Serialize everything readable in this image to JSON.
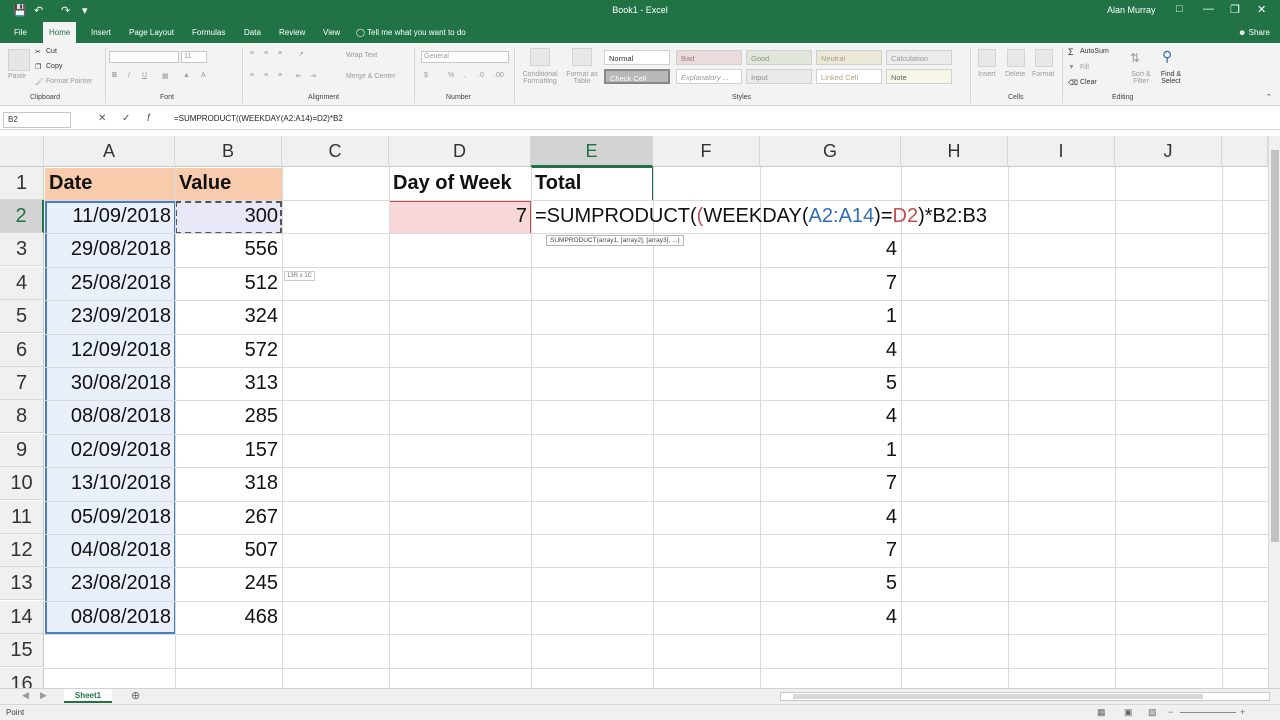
{
  "window": {
    "title": "Book1 - Excel",
    "user": "Alan Murray"
  },
  "tabs": [
    "File",
    "Home",
    "Insert",
    "Page Layout",
    "Formulas",
    "Data",
    "Review",
    "View"
  ],
  "tell_me": "Tell me what you want to do",
  "share": "Share",
  "ribbon": {
    "clipboard": {
      "paste": "Paste",
      "cut": "Cut",
      "copy": "Copy",
      "format_painter": "Format Painter",
      "label": "Clipboard"
    },
    "font": {
      "size": "11",
      "label": "Font"
    },
    "alignment": {
      "wrap": "Wrap Text",
      "merge": "Merge & Center",
      "label": "Alignment"
    },
    "number": {
      "format": "General",
      "label": "Number"
    },
    "styles": {
      "conditional": "Conditional Formatting",
      "format_table": "Format as Table",
      "cells": [
        "Normal",
        "Bad",
        "Good",
        "Neutral",
        "Calculation",
        "Check Cell",
        "Explanatory ...",
        "Input",
        "Linked Cell",
        "Note"
      ],
      "label": "Styles"
    },
    "cells": {
      "insert": "Insert",
      "delete": "Delete",
      "format": "Format",
      "label": "Cells"
    },
    "editing": {
      "autosum": "AutoSum",
      "fill": "Fill",
      "clear": "Clear",
      "sort": "Sort & Filter",
      "find": "Find & Select",
      "label": "Editing"
    }
  },
  "formula_bar": {
    "name_box": "B2",
    "formula": "=SUMPRODUCT((WEEKDAY(A2:A14)=D2)*B2"
  },
  "columns": [
    "A",
    "B",
    "C",
    "D",
    "E",
    "F",
    "G",
    "H",
    "I",
    "J"
  ],
  "rows": [
    "1",
    "2",
    "3",
    "4",
    "5",
    "6",
    "7",
    "8",
    "9",
    "10",
    "11",
    "12",
    "13",
    "14",
    "15",
    "16"
  ],
  "headers": {
    "a1": "Date",
    "b1": "Value",
    "d1": "Day of Week",
    "e1": "Total"
  },
  "data_rows": [
    {
      "date": "11/09/2018",
      "value": "300",
      "weekday": ""
    },
    {
      "date": "29/08/2018",
      "value": "556",
      "weekday": "4"
    },
    {
      "date": "25/08/2018",
      "value": "512",
      "weekday": "7"
    },
    {
      "date": "23/09/2018",
      "value": "324",
      "weekday": "1"
    },
    {
      "date": "12/09/2018",
      "value": "572",
      "weekday": "4"
    },
    {
      "date": "30/08/2018",
      "value": "313",
      "weekday": "5"
    },
    {
      "date": "08/08/2018",
      "value": "285",
      "weekday": "4"
    },
    {
      "date": "02/09/2018",
      "value": "157",
      "weekday": "1"
    },
    {
      "date": "13/10/2018",
      "value": "318",
      "weekday": "7"
    },
    {
      "date": "05/09/2018",
      "value": "267",
      "weekday": "4"
    },
    {
      "date": "04/08/2018",
      "value": "507",
      "weekday": "7"
    },
    {
      "date": "23/08/2018",
      "value": "245",
      "weekday": "5"
    },
    {
      "date": "08/08/2018",
      "value": "468",
      "weekday": "4"
    }
  ],
  "d2_value": "7",
  "e2_formula": {
    "p1": "=SUMPRODUCT(",
    "p2": "(",
    "p3": "WEEKDAY(",
    "p4": "A2:A14",
    "p5": ")=",
    "p6": "D2",
    "p7": ")*B2:B3"
  },
  "tooltip": "SUMPRODUCT(array1, [array2], [array3], ...)",
  "size_tip": "13R x 1C",
  "sheet_tab": "Sheet1",
  "status": "Point",
  "colors": {
    "excel_green": "#217346",
    "range_blue": "#2f6db5",
    "range_red": "#c0504d"
  }
}
